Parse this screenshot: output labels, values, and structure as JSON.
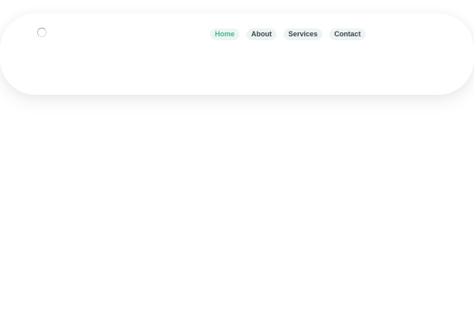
{
  "nav": {
    "items": [
      {
        "label": "Home",
        "active": true
      },
      {
        "label": "About",
        "active": false
      },
      {
        "label": "Services",
        "active": false
      },
      {
        "label": "Contact",
        "active": false
      }
    ]
  },
  "colors": {
    "active_text": "#4cb592",
    "text": "#3c4650",
    "pill_background": "#eef3f3"
  },
  "icons": {
    "logo": "loading-spinner-icon"
  }
}
